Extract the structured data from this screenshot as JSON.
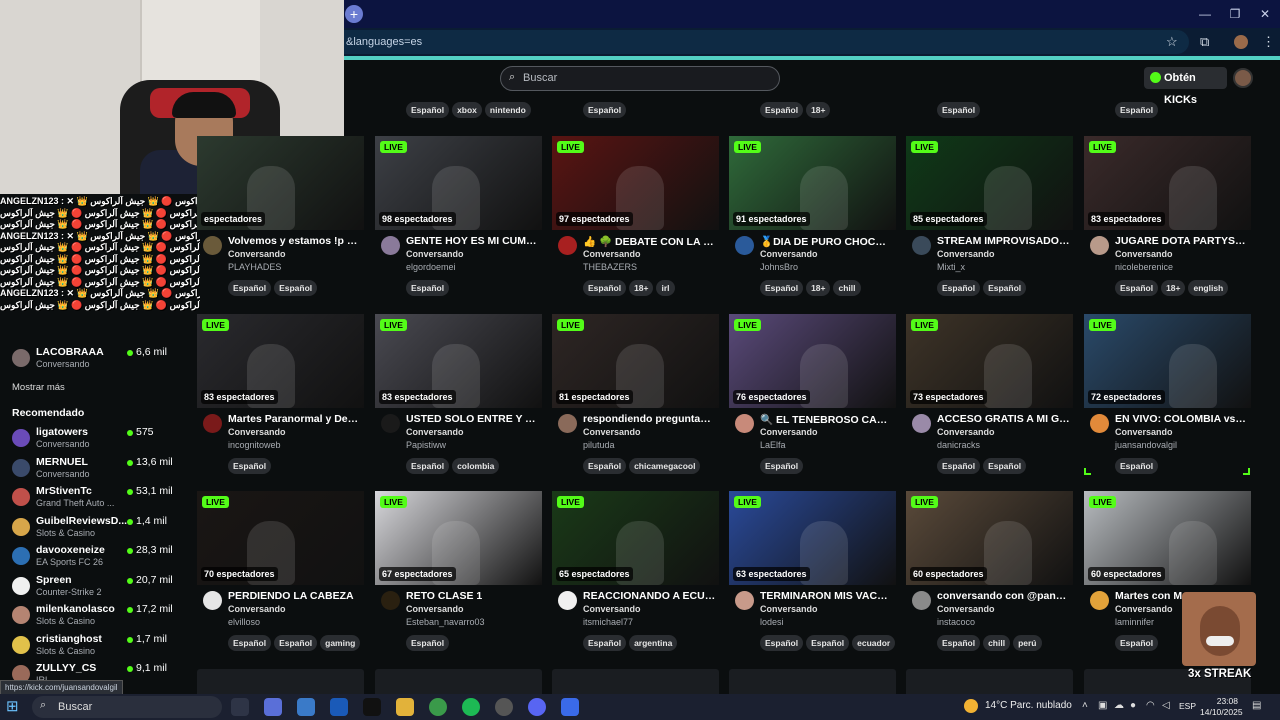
{
  "browser": {
    "address": "&languages=es",
    "new_tab": "+"
  },
  "header": {
    "search_placeholder": "Buscar",
    "kicks_button": "Obtén KICKs"
  },
  "chat_overlay": [
    "ANGELZN123 : ✕ 👑 جيش آلراكوس 🔴 👑 جيش آلراكوس",
    "جيش آلراكوس 🔴 👑 جيش آلراكوس 🔴 👑 جيش آلراكوس",
    "جيش آلراكوس 🔴 👑 جيش آلراكوس 🔴 👑 جيش آلراكوس",
    "ANGELZN123 : ✕ 👑 جيش آلراكوس 🔴 👑 جيش آلراكوس",
    "جيش آلراكوس 🔴 👑 جيش آلراكوس 🔴 👑 جيش آلراكوس",
    "جيش آلراكوس 🔴 👑 جيش آلراكوس 🔴 👑 جيش آلراكوس",
    "جيش آلراكوس 🔴 👑 جيش آلراكوس 🔴 👑 جيش آلراكوس",
    "جيش آلراكوس 🔴 👑 جيش آلراكوس 🔴 👑 جيش آلراكوس",
    "ANGELZN123 : ✕ 👑 جيش آلراكوس 🔴 👑 جيش آلراكوس",
    "جيش آلراكوس 🔴 👑 جيش آلراكوس 🔴 👑 جيش آلراكوس"
  ],
  "sidebar": {
    "following_last": {
      "name": "LACOBRAAA",
      "category": "Conversando",
      "viewers": "6,6 mil"
    },
    "show_more": "Mostrar más",
    "recommended_title": "Recomendado",
    "recommended": [
      {
        "name": "ligatowers",
        "category": "Conversando",
        "viewers": "575",
        "color": "#6a4bb8"
      },
      {
        "name": "MERNUEL",
        "category": "Conversando",
        "viewers": "13,6 mil",
        "color": "#3a4a6a"
      },
      {
        "name": "MrStivenTc",
        "category": "Grand Theft Auto ...",
        "viewers": "53,1 mil",
        "color": "#c0504a"
      },
      {
        "name": "GuibelReviewsD...",
        "category": "Slots & Casino",
        "viewers": "1,4 mil",
        "color": "#d7a64a"
      },
      {
        "name": "davooxeneize",
        "category": "EA Sports FC 26",
        "viewers": "28,3 mil",
        "color": "#2c6fb3"
      },
      {
        "name": "Spreen",
        "category": "Counter-Strike 2",
        "viewers": "20,7 mil",
        "color": "#f0f0f0"
      },
      {
        "name": "milenkanolasco",
        "category": "Slots & Casino",
        "viewers": "17,2 mil",
        "color": "#b58472"
      },
      {
        "name": "cristianghost",
        "category": "Slots & Casino",
        "viewers": "1,7 mil",
        "color": "#e1c14a"
      },
      {
        "name": "ZULLYY_CS",
        "category": "IRL",
        "viewers": "9,1 mil",
        "color": "#9a6a5a"
      }
    ]
  },
  "top_tags": [
    {
      "tags": [
        "Español",
        "xbox",
        "nintendo"
      ]
    },
    {
      "tags": [
        "Español"
      ]
    },
    {
      "tags": [
        "Español",
        "18+"
      ]
    },
    {
      "tags": [
        "Español"
      ]
    },
    {
      "tags": [
        "Español"
      ]
    }
  ],
  "rows": [
    [
      {
        "viewers": "espectadores",
        "title": "Volvemos y estamos !p p...",
        "category": "Conversando",
        "channel": "PLAYHADES",
        "tags": [
          "Español",
          "Español"
        ],
        "bg": "#2c3a2f",
        "avatar": "#6a5a3a",
        "live": false
      },
      {
        "viewers": "98 espectadores",
        "title": "GENTE HOY ES MI CUMP...",
        "category": "Conversando",
        "channel": "elgordoemei",
        "tags": [
          "Español"
        ],
        "bg": "#3d4046",
        "avatar": "#8a7a9a",
        "live": true
      },
      {
        "viewers": "97 espectadores",
        "title": "👍 🌳 DEBATE CON LA CO...",
        "category": "Conversando",
        "channel": "THEBAZERS",
        "tags": [
          "Español",
          "18+",
          "irl"
        ],
        "bg": "#5a1412",
        "avatar": "#a82020",
        "live": true
      },
      {
        "viewers": "91 espectadores",
        "title": "🥇DIA DE PURO CHOCOLA...",
        "category": "Conversando",
        "channel": "JohnsBro",
        "tags": [
          "Español",
          "18+",
          "chill"
        ],
        "bg": "#2f6a3a",
        "avatar": "#2a5a9a",
        "live": true
      },
      {
        "viewers": "85 espectadores",
        "title": "STREAM IMPROVISADO C...",
        "category": "Conversando",
        "channel": "Mixti_x",
        "tags": [
          "Español",
          "Español"
        ],
        "bg": "#0f3a18",
        "avatar": "#3a4a5a",
        "live": true
      },
      {
        "viewers": "83 espectadores",
        "title": "JUGARE DOTA PARTYS, L...",
        "category": "Conversando",
        "channel": "nicoleberenice",
        "tags": [
          "Español",
          "18+",
          "english"
        ],
        "bg": "#3a2a2a",
        "avatar": "#b89a8a",
        "live": true
      }
    ],
    [
      {
        "viewers": "83 espectadores",
        "title": "Martes Paranormal y Dee...",
        "category": "Conversando",
        "channel": "incognitoweb",
        "tags": [
          "Español"
        ],
        "bg": "#2a2a2e",
        "avatar": "#7a1a1a",
        "live": true
      },
      {
        "viewers": "83 espectadores",
        "title": "USTED SOLO ENTRE Y YA...",
        "category": "Conversando",
        "channel": "Papistiww",
        "tags": [
          "Español",
          "colombia"
        ],
        "bg": "#4a4a52",
        "avatar": "#1a1a1a",
        "live": true
      },
      {
        "viewers": "81 espectadores",
        "title": "respondiendo preguntas ...",
        "category": "Conversando",
        "channel": "pilutuda",
        "tags": [
          "Español",
          "chicamegacool"
        ],
        "bg": "#2e2624",
        "avatar": "#8a6a5a",
        "live": true
      },
      {
        "viewers": "76 espectadores",
        "title": "🔍 EL TENEBROSO CASO ...",
        "category": "Conversando",
        "channel": "LaElfa",
        "tags": [
          "Español"
        ],
        "bg": "#5a4a7a",
        "avatar": "#c88a7a",
        "live": true
      },
      {
        "viewers": "73 espectadores",
        "title": "ACCESO GRATIS A MI GR...",
        "category": "Conversando",
        "channel": "danicracks",
        "tags": [
          "Español",
          "Español"
        ],
        "bg": "#3e3428",
        "avatar": "#9a8aa8",
        "live": true
      },
      {
        "viewers": "72 espectadores",
        "title": "EN VIVO: COLOMBIA vs C...",
        "category": "Conversando",
        "channel": "juansandovalgil",
        "tags": [
          "Español"
        ],
        "bg": "#2a4a6a",
        "avatar": "#e28a3a",
        "live": true
      }
    ],
    [
      {
        "viewers": "70 espectadores",
        "title": "PERDIENDO LA CABEZA",
        "category": "Conversando",
        "channel": "elvilloso",
        "tags": [
          "Español",
          "Español",
          "gaming"
        ],
        "bg": "#1a1614",
        "avatar": "#e6e6e6",
        "live": true
      },
      {
        "viewers": "67 espectadores",
        "title": "RETO CLASE 1",
        "category": "Conversando",
        "channel": "Esteban_navarro03",
        "tags": [
          "Español"
        ],
        "bg": "#d8d8dc",
        "avatar": "#2a2010",
        "live": true
      },
      {
        "viewers": "65 espectadores",
        "title": "REACCIONANDO A ECUA...",
        "category": "Conversando",
        "channel": "itsmichael77",
        "tags": [
          "Español",
          "argentina"
        ],
        "bg": "#1a3a18",
        "avatar": "#f0f0f0",
        "live": true
      },
      {
        "viewers": "63 espectadores",
        "title": "TERMINARON MIS VACAC...",
        "category": "Conversando",
        "channel": "lodesi",
        "tags": [
          "Español",
          "Español",
          "ecuador"
        ],
        "bg": "#2a4a9a",
        "avatar": "#c89a8a",
        "live": true
      },
      {
        "viewers": "60 espectadores",
        "title": "conversando con @pane...",
        "category": "Conversando",
        "channel": "instacoco",
        "tags": [
          "Español",
          "chill",
          "perú"
        ],
        "bg": "#5a4a3a",
        "avatar": "#8a8a8a",
        "live": true
      },
      {
        "viewers": "60 espectadores",
        "title": "Martes con M",
        "category": "Conversando",
        "channel": "laminnifer",
        "tags": [
          "Español"
        ],
        "bg": "#b8bcc0",
        "avatar": "#e2a23a",
        "live": true
      }
    ]
  ],
  "live_label": "LIVE",
  "streak": "3x STREAK",
  "status_url": "https://kick.com/juansandovalgil",
  "taskbar": {
    "search": "Buscar",
    "weather": "14°C  Parc. nublado",
    "lang": "ESP",
    "time": "23:08",
    "date": "14/10/2025"
  }
}
